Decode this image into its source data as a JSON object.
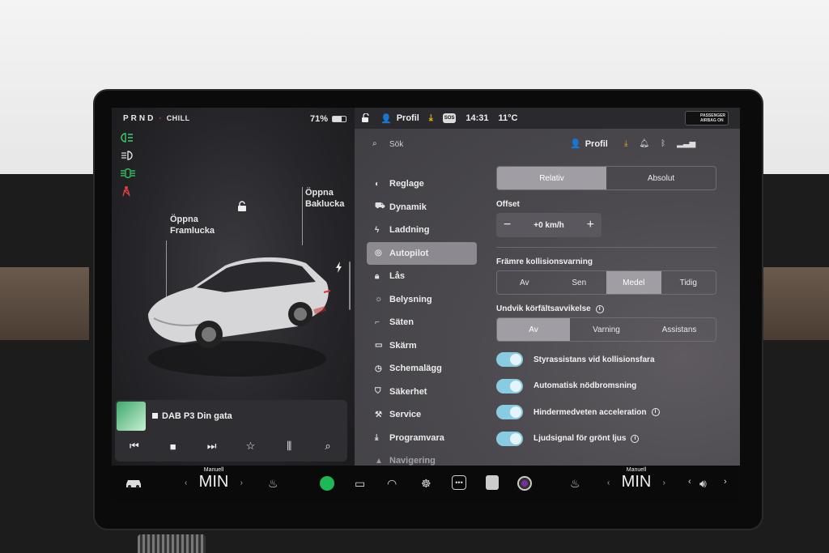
{
  "left_panel": {
    "gear_selector": "PRND",
    "drive_mode": "CHILL",
    "battery_percent": "71%",
    "battery_level": 0.71,
    "label_front_trunk": "Öppna\nFramlucka",
    "label_rear_trunk": "Öppna\nBaklucka",
    "status_icons": [
      "headlights-icon",
      "low-beam-icon",
      "fog-lights-icon",
      "seatbelt-warning-icon"
    ]
  },
  "media": {
    "station": "DAB P3 Din gata",
    "controls": [
      "previous-icon",
      "stop-icon",
      "next-icon",
      "favorite-icon",
      "equalizer-icon",
      "search-icon"
    ]
  },
  "topbar": {
    "profile": "Profil",
    "sos": "SOS",
    "time": "14:31",
    "temperature": "11°C",
    "airbag_line1": "PASSENGER",
    "airbag_line2": "AIRBAG ON"
  },
  "search": {
    "placeholder": "Sök",
    "profile": "Profil"
  },
  "menu": {
    "items": [
      {
        "label": "Reglage",
        "icon": "toggle-icon"
      },
      {
        "label": "Dynamik",
        "icon": "car-icon"
      },
      {
        "label": "Laddning",
        "icon": "bolt-icon"
      },
      {
        "label": "Autopilot",
        "icon": "steering-wheel-icon"
      },
      {
        "label": "Lås",
        "icon": "lock-icon"
      },
      {
        "label": "Belysning",
        "icon": "sun-icon"
      },
      {
        "label": "Säten",
        "icon": "seat-icon"
      },
      {
        "label": "Skärm",
        "icon": "display-icon"
      },
      {
        "label": "Schemalägg",
        "icon": "clock-icon"
      },
      {
        "label": "Säkerhet",
        "icon": "shield-icon"
      },
      {
        "label": "Service",
        "icon": "wrench-icon"
      },
      {
        "label": "Programvara",
        "icon": "download-icon"
      },
      {
        "label": "Navigering",
        "icon": "navigation-icon"
      }
    ],
    "active_index": 3
  },
  "autopilot": {
    "speed_mode": {
      "options": [
        "Relativ",
        "Absolut"
      ],
      "selected": 0
    },
    "offset_label": "Offset",
    "offset_value": "+0 km/h",
    "collision_label": "Främre kollisionsvarning",
    "collision": {
      "options": [
        "Av",
        "Sen",
        "Medel",
        "Tidig"
      ],
      "selected": 2
    },
    "lane_label": "Undvik körfältsavvikelse",
    "lane": {
      "options": [
        "Av",
        "Varning",
        "Assistans"
      ],
      "selected": 0
    },
    "toggles": [
      {
        "label": "Styrassistans vid kollisionsfara",
        "on": true,
        "info": false
      },
      {
        "label": "Automatisk nödbromsning",
        "on": true,
        "info": false
      },
      {
        "label": "Hindermedveten acceleration",
        "on": true,
        "info": true
      },
      {
        "label": "Ljudsignal för grönt ljus",
        "on": true,
        "info": true
      }
    ]
  },
  "bottom_bar": {
    "driver_temp_mode": "Manuell",
    "driver_temp": "MIN",
    "passenger_temp_mode": "Manuell",
    "passenger_temp": "MIN",
    "icons": [
      "car-icon",
      "seat-heat-left-icon",
      "spotify-icon",
      "rear-defrost-icon",
      "front-defrost-icon",
      "wheel-heat-icon",
      "more-icon",
      "app-icon",
      "camera-icon",
      "seat-heat-right-icon",
      "volume-icon"
    ]
  },
  "colors": {
    "toggle_on": "#89cbe0",
    "download_accent": "#f0b400",
    "segment_selected": "#a09ea4"
  }
}
